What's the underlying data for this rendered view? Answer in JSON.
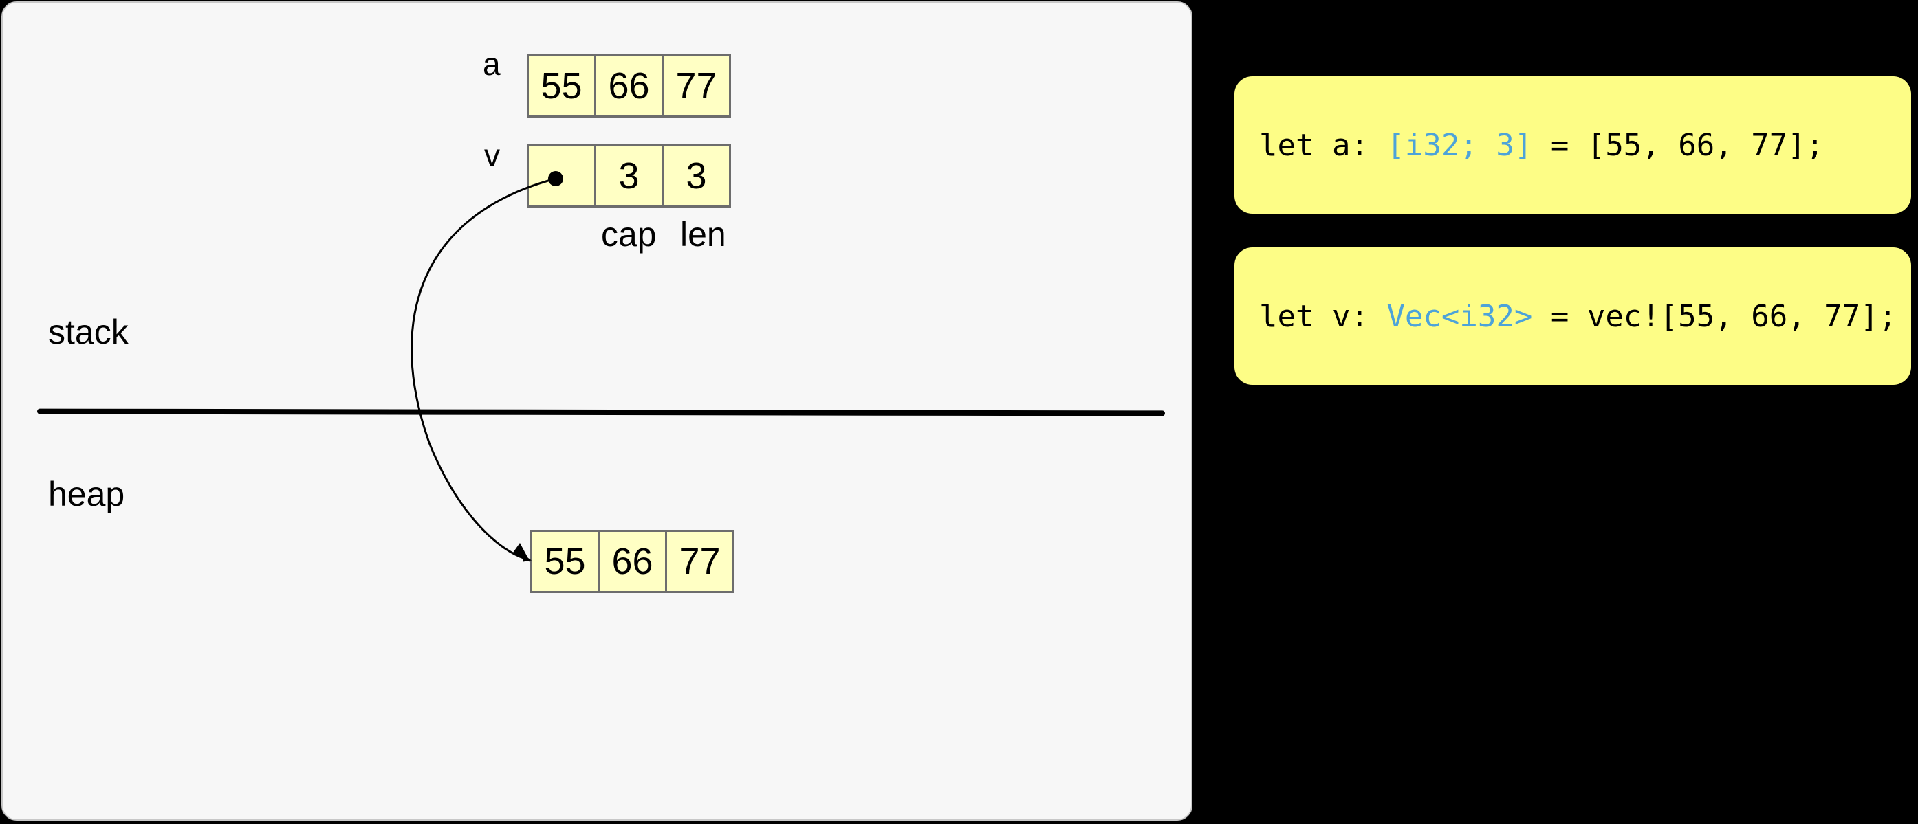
{
  "diagram": {
    "stack_label": "stack",
    "heap_label": "heap",
    "array_a": {
      "label": "a",
      "cells": [
        "55",
        "66",
        "77"
      ]
    },
    "vec_v": {
      "label": "v",
      "cap_value": "3",
      "len_value": "3",
      "cap_label": "cap",
      "len_label": "len"
    },
    "heap_buffer": {
      "cells": [
        "55",
        "66",
        "77"
      ]
    }
  },
  "code": {
    "line_a": {
      "prefix": "let a: ",
      "type": "[i32; 3]",
      "suffix": " = [55, 66, 77];"
    },
    "line_v": {
      "prefix": "let v: ",
      "type": "Vec<i32>",
      "suffix": " = vec![55, 66, 77];"
    }
  },
  "colors": {
    "background": "#000000",
    "panel": "#f7f7f7",
    "cell_fill": "#ffffc4",
    "code_card": "#fdfd86",
    "type_highlight": "#4da3d9"
  }
}
